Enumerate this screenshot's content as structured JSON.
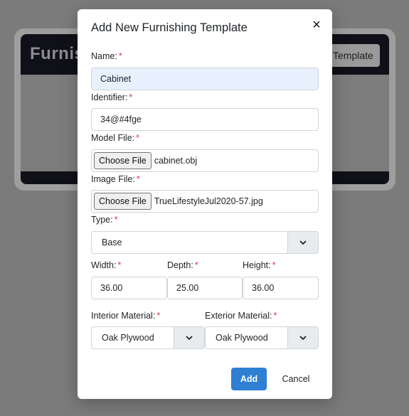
{
  "background": {
    "title": "Furnis",
    "button_label": "Template"
  },
  "modal": {
    "title": "Add New Furnishing Template",
    "close_icon": "×",
    "required_marker": "*",
    "fields": {
      "name": {
        "label": "Name:",
        "value": "Cabinet"
      },
      "identifier": {
        "label": "Identifier:",
        "value": "34@#4fge"
      },
      "model_file": {
        "label": "Model File:",
        "button": "Choose File",
        "file": "cabinet.obj"
      },
      "image_file": {
        "label": "Image File:",
        "button": "Choose File",
        "file": "TrueLifestyleJul2020-57.jpg"
      },
      "type": {
        "label": "Type:",
        "value": "Base"
      },
      "width": {
        "label": "Width:",
        "value": "36.00"
      },
      "depth": {
        "label": "Depth:",
        "value": "25.00"
      },
      "height": {
        "label": "Height:",
        "value": "36.00"
      },
      "interior_material": {
        "label": "Interior Material:",
        "value": "Oak Plywood"
      },
      "exterior_material": {
        "label": "Exterior Material:",
        "value": "Oak Plywood"
      }
    },
    "add_label": "Add",
    "cancel_label": "Cancel"
  },
  "colors": {
    "primary": "#2f7fd3",
    "required": "#dc3545",
    "autofill_bg": "#e8f0fe"
  }
}
